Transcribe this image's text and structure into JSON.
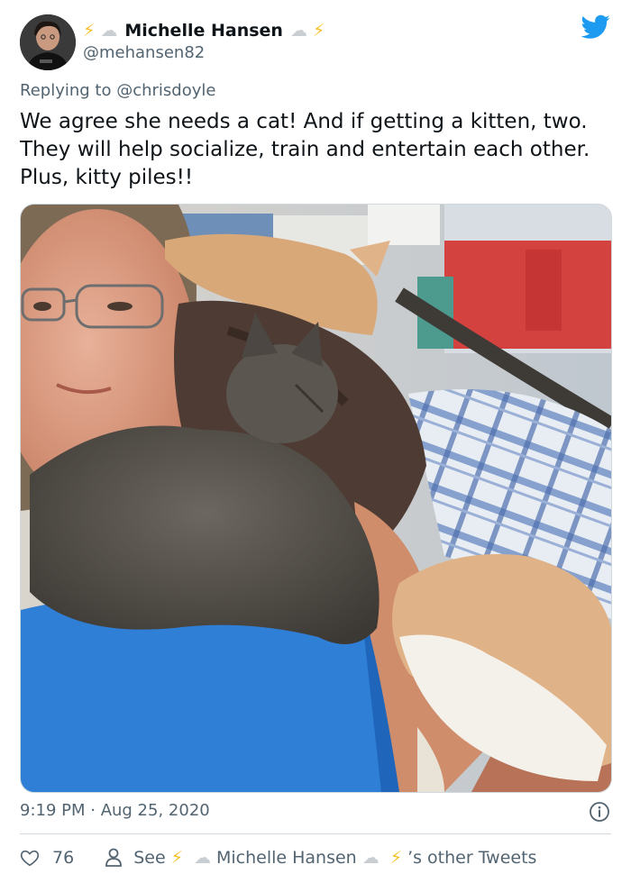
{
  "tweet": {
    "author": {
      "display_name": "Michelle Hansen",
      "handle": "@mehansen82",
      "emoji_lightning": "⚡",
      "emoji_cloud": "☁"
    },
    "reply_prefix": "Replying to ",
    "reply_mention": "@chrisdoyle",
    "text": "We agree she needs a cat! And if getting a kitten, two. They will help socialize, train and entertain each other. Plus, kitty piles!!",
    "timestamp": "9:19 PM · Aug 25, 2020"
  },
  "footer": {
    "likes": "76",
    "see_label": "See",
    "other_tweets_suffix": "’s other Tweets"
  },
  "colors": {
    "twitter_blue": "#1d9bf0",
    "secondary_text": "#536471",
    "shirt_blue": "#2f7fd6"
  },
  "icons": {
    "brand": "twitter-bird-icon",
    "info": "info-icon",
    "like": "heart-icon",
    "profile": "person-icon"
  }
}
